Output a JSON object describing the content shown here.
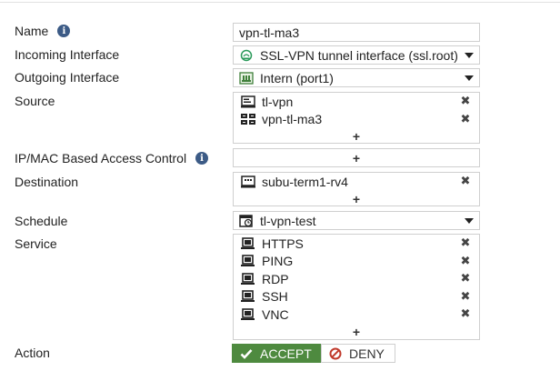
{
  "form": {
    "name": {
      "label": "Name",
      "value": "vpn-tl-ma3"
    },
    "incoming": {
      "label": "Incoming Interface",
      "value": "SSL-VPN tunnel interface (ssl.root)"
    },
    "outgoing": {
      "label": "Outgoing Interface",
      "value": "Intern (port1)"
    },
    "source": {
      "label": "Source",
      "items": [
        "tl-vpn",
        "vpn-tl-ma3"
      ]
    },
    "ipmac": {
      "label": "IP/MAC Based Access Control"
    },
    "destination": {
      "label": "Destination",
      "items": [
        "subu-term1-rv4"
      ]
    },
    "schedule": {
      "label": "Schedule",
      "value": "tl-vpn-test"
    },
    "service": {
      "label": "Service",
      "items": [
        "HTTPS",
        "PING",
        "RDP",
        "SSH",
        "VNC"
      ]
    },
    "action": {
      "label": "Action",
      "accept_label": "ACCEPT",
      "deny_label": "DENY",
      "selected": "ACCEPT"
    }
  },
  "symbols": {
    "info": "i",
    "plus": "+",
    "remove": "✖"
  },
  "icons": {
    "info": "info-icon",
    "incoming": "tunnel-interface-icon",
    "outgoing": "network-port-icon",
    "source_items": [
      "user-icon",
      "user-group-icon"
    ],
    "destination_items": [
      "address-icon"
    ],
    "schedule": "schedule-icon",
    "service_items": "service-monitor-icon",
    "remove": "close-icon",
    "add": "plus-icon",
    "accept": "checkmark-icon",
    "deny": "deny-icon"
  },
  "colors": {
    "accept": "#4e8a3f",
    "deny": "#c0392b",
    "info": "#3c5b86"
  }
}
